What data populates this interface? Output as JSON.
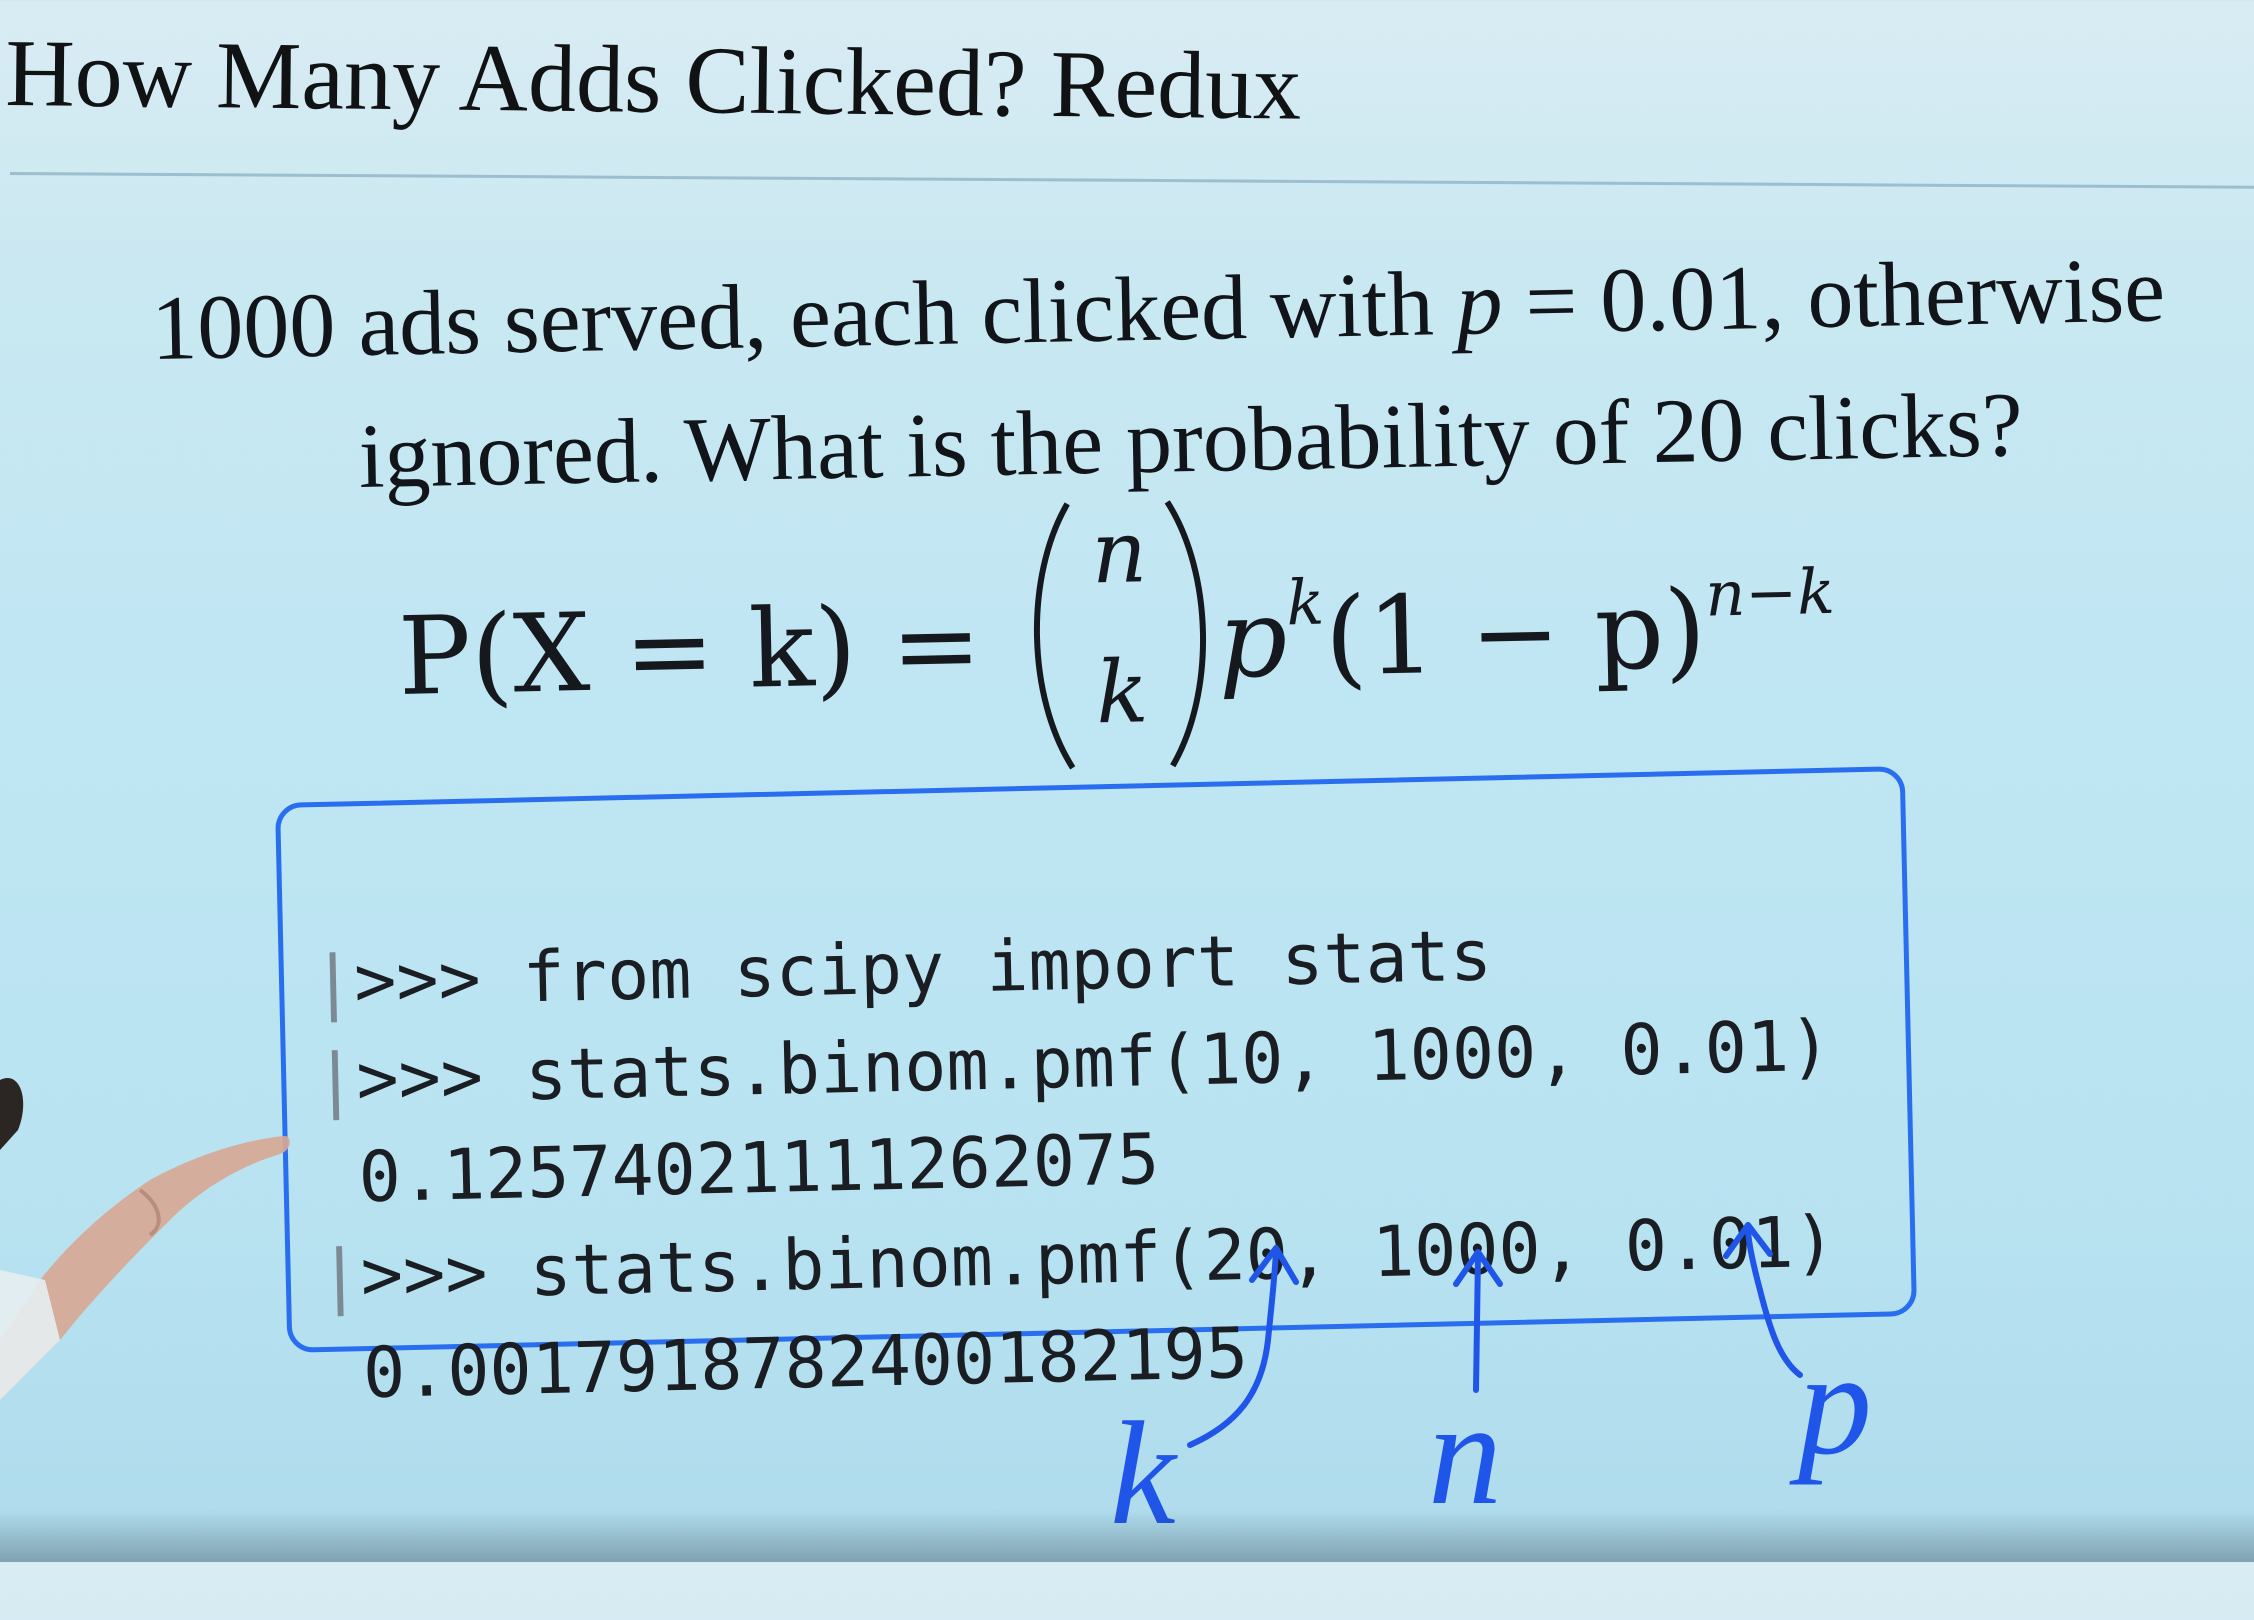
{
  "slide": {
    "title": "How Many Adds Clicked? Redux",
    "question": {
      "line1_prefix": "1000 ads served, each clicked with ",
      "line1_var": "p",
      "line1_suffix": " = 0.01, otherwise",
      "line2": "ignored. What is the probability of 20 clicks?"
    },
    "formula": {
      "lhs": "P(X = k) = ",
      "binom_top": "n",
      "binom_bottom": "k",
      "rhs_base1": "p",
      "rhs_exp1": "k",
      "rhs_middle": "(1 − p)",
      "rhs_exp2": "n−k"
    },
    "code": {
      "lines": [
        {
          "prompt": ">>> ",
          "text": "from scipy import stats"
        },
        {
          "prompt": ">>> ",
          "text": "stats.binom.pmf(10, 1000, 0.01)"
        },
        {
          "prompt": "",
          "text": "0.12574021111262075"
        },
        {
          "prompt": ">>> ",
          "text": "stats.binom.pmf(20, 1000, 0.01)"
        },
        {
          "prompt": "",
          "text": "0.0017918782400182195"
        }
      ]
    },
    "annotations": {
      "k": "k",
      "n": "n",
      "p": "p"
    },
    "colors": {
      "ink": "#111418",
      "annotation_blue": "#1f55e8",
      "box_border": "#2a6ef0"
    }
  }
}
